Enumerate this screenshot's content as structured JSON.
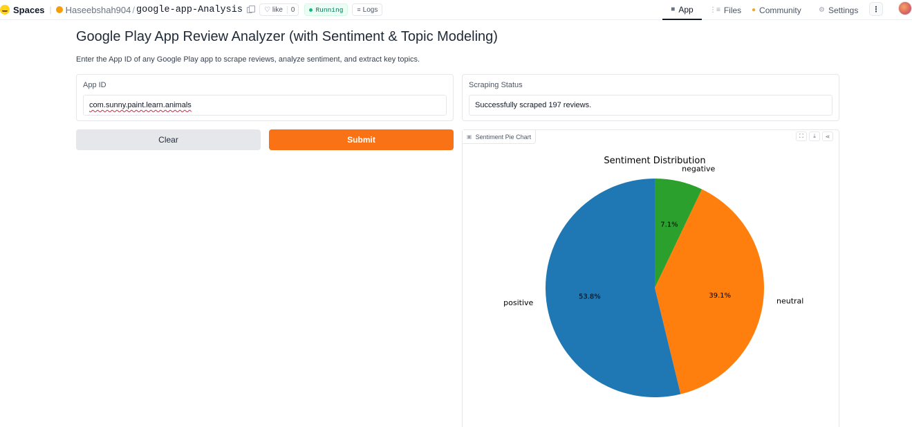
{
  "topbar": {
    "spaces_label": "Spaces",
    "owner": "Haseebshah904",
    "repo": "google-app-Analysis",
    "like_label": "like",
    "like_count": "0",
    "status": "Running",
    "logs_label": "Logs",
    "nav": {
      "app": "App",
      "files": "Files",
      "community": "Community",
      "settings": "Settings"
    }
  },
  "page": {
    "title": "Google Play App Review Analyzer (with Sentiment & Topic Modeling)",
    "description": "Enter the App ID of any Google Play app to scrape reviews, analyze sentiment, and extract key topics."
  },
  "app_id": {
    "label": "App ID",
    "value": "com.sunny.paint.learn.animals"
  },
  "status_box": {
    "label": "Scraping Status",
    "value": "Successfully scraped 197 reviews."
  },
  "buttons": {
    "clear": "Clear",
    "submit": "Submit"
  },
  "plot": {
    "tag_label": "Sentiment Pie Chart"
  },
  "colors": {
    "accent": "#f97316",
    "positive": "#1f77b4",
    "neutral": "#ff7f0e",
    "negative": "#2ca02c"
  },
  "chart_data": {
    "type": "pie",
    "title": "Sentiment Distribution",
    "categories": [
      "negative",
      "neutral",
      "positive"
    ],
    "values": [
      7.1,
      39.1,
      53.8
    ],
    "labels": [
      "7.1%",
      "39.1%",
      "53.8%"
    ],
    "colors": [
      "#2ca02c",
      "#ff7f0e",
      "#1f77b4"
    ],
    "start_angle_deg": 90,
    "direction": "clockwise"
  }
}
